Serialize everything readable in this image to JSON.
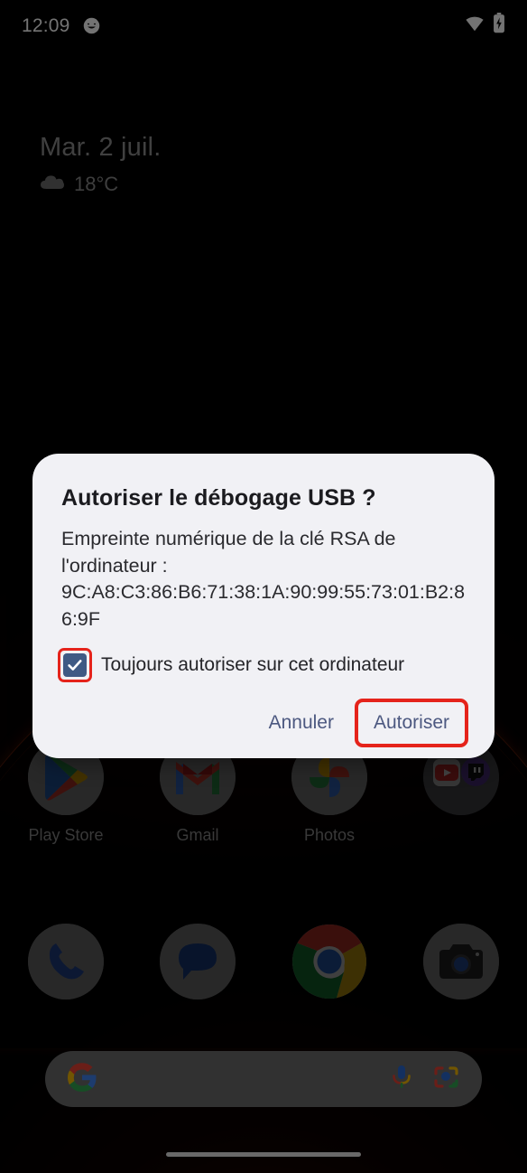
{
  "status_bar": {
    "time": "12:09",
    "notification_icon": "app-notification-icon",
    "wifi_icon": "wifi-icon",
    "battery_icon": "battery-charging-icon"
  },
  "home_widget": {
    "date": "Mar. 2 juil.",
    "weather_icon": "cloud-icon",
    "temperature": "18°C"
  },
  "app_rows": [
    {
      "name": "home-apps-row",
      "apps": [
        {
          "label": "Play Store",
          "icon": "play-store-icon"
        },
        {
          "label": "Gmail",
          "icon": "gmail-icon"
        },
        {
          "label": "Photos",
          "icon": "google-photos-icon"
        },
        {
          "label": "",
          "icon": "app-folder-icon"
        }
      ]
    },
    {
      "name": "dock-row",
      "apps": [
        {
          "label": "",
          "icon": "phone-icon"
        },
        {
          "label": "",
          "icon": "messages-icon"
        },
        {
          "label": "",
          "icon": "chrome-icon"
        },
        {
          "label": "",
          "icon": "camera-icon"
        }
      ]
    }
  ],
  "search_bar": {
    "placeholder": "",
    "google_icon": "google-g-icon",
    "mic_icon": "microphone-icon",
    "lens_icon": "google-lens-icon"
  },
  "dialog": {
    "title": "Autoriser le débogage USB ?",
    "body_line1": "Empreinte numérique de la clé RSA de l'ordinateur :",
    "fingerprint": "9C:A8:C3:86:B6:71:38:1A:90:99:55:73:01:B2:86:9F",
    "checkbox_label": "Toujours autoriser sur cet ordinateur",
    "checkbox_checked": true,
    "cancel_label": "Annuler",
    "allow_label": "Autoriser"
  },
  "colors": {
    "dialog_background": "#F1F1F5",
    "dialog_title": "#1B1B1F",
    "button_text": "#4C5880",
    "checkbox_fill": "#3F5A84",
    "highlight": "#E5231B",
    "wallpaper": "#000000",
    "label_text": "#8D8D8D"
  },
  "gesture_bar": {
    "name": "gesture-pill"
  }
}
